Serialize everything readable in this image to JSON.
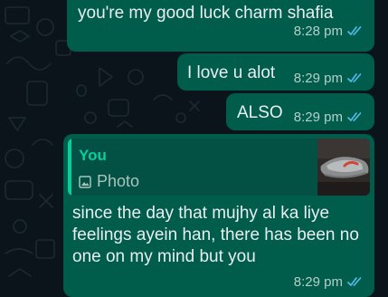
{
  "messages": [
    {
      "text": "you're my good luck charm shafia",
      "time": "8:28 pm"
    },
    {
      "text": "I love u alot",
      "time": "8:29 pm"
    },
    {
      "text": "ALSO",
      "time": "8:29 pm"
    },
    {
      "reply": {
        "author": "You",
        "type_label": "Photo",
        "icon": "photo-icon"
      },
      "text": "since the day that mujhy al ka liye feelings ayein han, there has been no one on my mind but you",
      "time": "8:29 pm"
    }
  ],
  "colors": {
    "background": "#0b141a",
    "outgoing_bubble": "#005c4b",
    "reply_accent": "#06cf9c",
    "read_ticks": "#53bdeb"
  },
  "icons": {
    "read_receipt": "double-check-icon",
    "photo": "photo-icon"
  }
}
